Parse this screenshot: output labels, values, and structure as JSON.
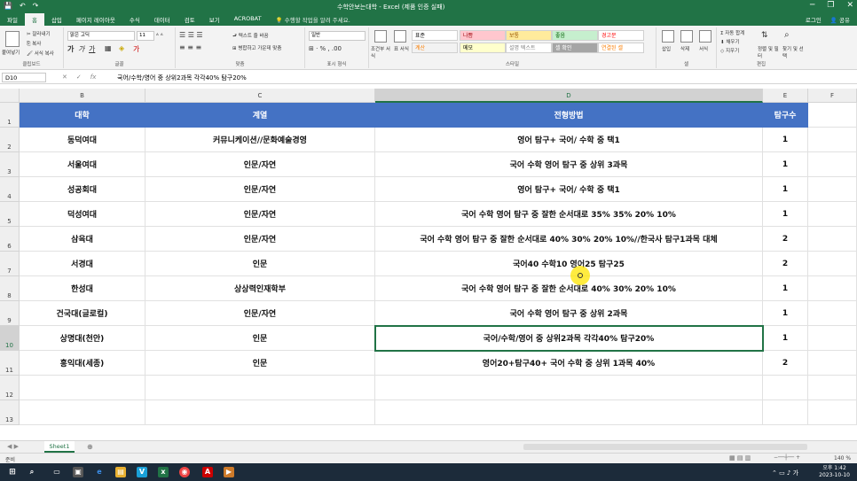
{
  "app": {
    "title": "수학안보는대학 - Excel (제품 인증 실패)",
    "qat": [
      "💾",
      "↶",
      "↷"
    ],
    "window_controls": [
      "─",
      "❐",
      "✕"
    ]
  },
  "tabs": [
    "파일",
    "홈",
    "삽입",
    "페이지 레이아웃",
    "수식",
    "데이터",
    "검토",
    "보기",
    "ACROBAT"
  ],
  "active_tab": "홈",
  "tell_me": "수행할 작업을 알려 주세요.",
  "account": {
    "login": "로그인",
    "share": "공유"
  },
  "ribbon": {
    "clipboard": {
      "label": "클립보드",
      "paste": "붙여넣기",
      "cut": "잘라내기",
      "copy": "복사",
      "format_painter": "서식 복사"
    },
    "font": {
      "label": "글꼴",
      "name": "맑은 고딕",
      "size": "11"
    },
    "align": {
      "label": "맞춤",
      "wrap": "텍스트 줄 바꿈",
      "merge": "병합하고 가운데 맞춤"
    },
    "number": {
      "label": "표시 형식",
      "format": "일반"
    },
    "cond_format": "조건부 서식",
    "table_format": "표 서식",
    "styles": {
      "label": "스타일",
      "cells": [
        {
          "name": "표준",
          "bg": "#ffffff",
          "fg": "#000000"
        },
        {
          "name": "나쁨",
          "bg": "#ffc7ce",
          "fg": "#9c0006"
        },
        {
          "name": "보통",
          "bg": "#ffeb9c",
          "fg": "#9c5700"
        },
        {
          "name": "좋음",
          "bg": "#c6efce",
          "fg": "#006100"
        },
        {
          "name": "경고문",
          "bg": "#ffffff",
          "fg": "#ff0000"
        },
        {
          "name": "계산",
          "bg": "#f2f2f2",
          "fg": "#fa7d00"
        },
        {
          "name": "메모",
          "bg": "#ffffcc",
          "fg": "#000000"
        },
        {
          "name": "설명 텍스트",
          "bg": "#ffffff",
          "fg": "#7f7f7f"
        },
        {
          "name": "셀 확인",
          "bg": "#a5a5a5",
          "fg": "#ffffff"
        },
        {
          "name": "연결된 셀",
          "bg": "#ffffff",
          "fg": "#fa7d00"
        }
      ]
    },
    "cells": {
      "label": "셀",
      "insert": "삽입",
      "delete": "삭제",
      "format": "서식"
    },
    "editing": {
      "label": "편집",
      "autosum": "자동 합계",
      "fill": "채우기",
      "clear": "지우기",
      "sort": "정렬 및 필터",
      "find": "찾기 및 선택"
    }
  },
  "formula_bar": {
    "name_box": "D10",
    "formula": "국어/수학/영어 중 상위2과목 각각40% 탐구20%"
  },
  "columns": [
    "B",
    "C",
    "D",
    "E",
    "F"
  ],
  "selected_column": "D",
  "selected_row": "10",
  "rows": [
    {
      "num": "1",
      "header": true,
      "b": "대학",
      "c": "계열",
      "d": "전형방법",
      "e": "탐구수"
    },
    {
      "num": "2",
      "b": "동덕여대",
      "c": "커뮤니케이션//문화예술경영",
      "d": "영어 탐구+ 국어/ 수학 중 택1",
      "e": "1"
    },
    {
      "num": "3",
      "b": "서울여대",
      "c": "인문/자연",
      "d": "국어 수학 영어 탐구 중 상위 3과목",
      "e": "1"
    },
    {
      "num": "4",
      "b": "성공회대",
      "c": "인문/자연",
      "d": "영어 탐구+ 국어/ 수학 중 택1",
      "e": "1"
    },
    {
      "num": "5",
      "b": "덕성여대",
      "c": "인문/자연",
      "d": "국어 수학 영어 탐구 중 잘한 순서대로 35% 35% 20% 10%",
      "e": "1"
    },
    {
      "num": "6",
      "b": "삼육대",
      "c": "인문/자연",
      "d": "국어 수학 영어 탐구 중 잘한 순서대로 40% 30% 20% 10%//한국사 탐구1과목 대체",
      "e": "2"
    },
    {
      "num": "7",
      "b": "서경대",
      "c": "인문",
      "d": "국어40 수학10 영어25 탐구25",
      "e": "2"
    },
    {
      "num": "8",
      "b": "한성대",
      "c": "상상력인재학부",
      "d": "국어 수학 영어 탐구 중 잘한 순서대로 40% 30% 20% 10%",
      "e": "1"
    },
    {
      "num": "9",
      "b": "건국대(글로컬)",
      "c": "인문/자연",
      "d": "국어 수학 영어 탐구 중 상위 2과목",
      "e": "1"
    },
    {
      "num": "10",
      "b": "상명대(천안)",
      "c": "인문",
      "d": "국어/수학/영어 중 상위2과목 각각40% 탐구20%",
      "e": "1"
    },
    {
      "num": "11",
      "b": "홍익대(세종)",
      "c": "인문",
      "d": "영어20+탐구40+ 국어 수학 중 상위 1과목 40%",
      "e": "2"
    },
    {
      "num": "12",
      "b": "",
      "c": "",
      "d": "",
      "e": ""
    },
    {
      "num": "13",
      "b": "",
      "c": "",
      "d": "",
      "e": ""
    }
  ],
  "sheet_tab": "Sheet1",
  "status": {
    "ready": "준비",
    "zoom": "140 %"
  },
  "clock": {
    "time": "오후 1:42",
    "date": "2023-10-10"
  },
  "colors": {
    "excel_green": "#217346",
    "header_blue": "#4472c4"
  }
}
